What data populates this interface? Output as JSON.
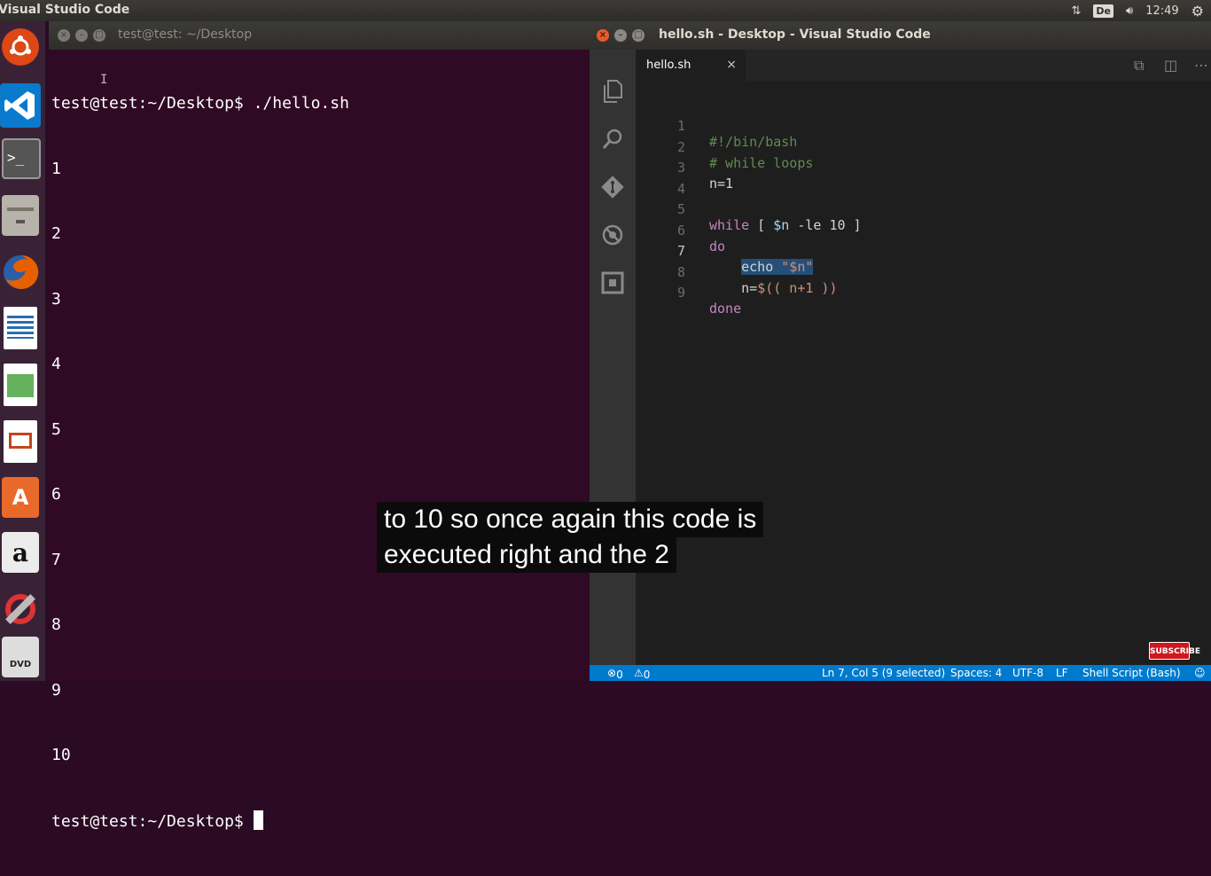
{
  "top_panel": {
    "app_title": "Visual Studio Code",
    "keyboard_layout": "De",
    "clock": "12:49"
  },
  "terminal": {
    "title": "test@test: ~/Desktop",
    "lines": [
      "test@test:~/Desktop$ ./hello.sh",
      "1",
      "2",
      "3",
      "4",
      "5",
      "6",
      "7",
      "8",
      "9",
      "10"
    ],
    "prompt": "test@test:~/Desktop$ "
  },
  "vscode": {
    "title": "hello.sh - Desktop - Visual Studio Code",
    "tab": {
      "label": "hello.sh",
      "close": "×"
    },
    "code": {
      "line_numbers": [
        "1",
        "2",
        "3",
        "4",
        "5",
        "6",
        "7",
        "8",
        "9"
      ],
      "l1": "#!/bin/bash",
      "l2": "# while loops",
      "l3": "n=1",
      "l5_kw": "while",
      "l5_a": " [ ",
      "l5_var": "$n",
      "l5_b": " -le 10 ]",
      "l6": "do",
      "l7_indent": "    ",
      "l7_cmd": "echo ",
      "l7_str": "\"$n\"",
      "l8_indent": "    ",
      "l8_a": "n=",
      "l8_b": "$(( n+1 ))",
      "l9": "done"
    },
    "status": {
      "errors": "0",
      "warnings": "0",
      "position": "Ln 7, Col 5 (9 selected)",
      "spaces": "Spaces: 4",
      "encoding": "UTF-8",
      "eol": "LF",
      "language": "Shell Script (Bash)"
    }
  },
  "subscribe": "SUBSCRIBE",
  "caption": {
    "line1": "to 10 so once again this code is",
    "line2": "executed right and the 2"
  },
  "colors": {
    "terminal_bg": "#300a24",
    "vscode_bg": "#1e1e1e",
    "status_bar": "#007acc",
    "selection": "#264f78"
  }
}
